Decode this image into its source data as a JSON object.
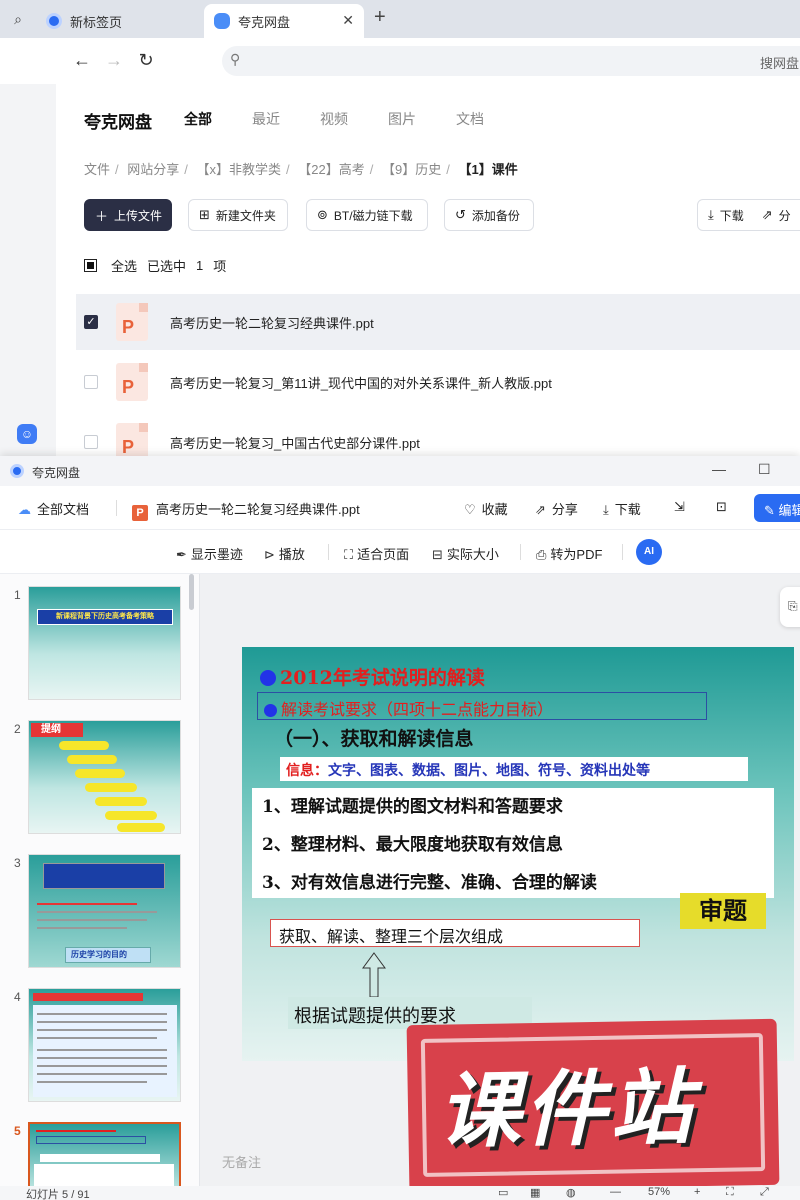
{
  "browser": {
    "tabs": [
      {
        "label": "新标签页"
      },
      {
        "label": "夸克网盘"
      }
    ],
    "address_hint": "搜网盘"
  },
  "drive": {
    "brand": "夸克网盘",
    "nav": [
      "全部",
      "最近",
      "视频",
      "图片",
      "文档"
    ],
    "breadcrumb": [
      "文件",
      "网站分享",
      "【x】非教学类",
      "【22】高考",
      "【9】历史",
      "【1】课件"
    ],
    "toolbar": {
      "upload": "上传文件",
      "new_folder": "新建文件夹",
      "bt": "BT/磁力链下载",
      "backup": "添加备份",
      "download": "下载",
      "share": "分"
    },
    "selection": {
      "all": "全选",
      "selected": "已选中",
      "count": "1",
      "unit": "项"
    },
    "files": [
      {
        "name": "高考历史一轮二轮复习经典课件.ppt"
      },
      {
        "name": "高考历史一轮复习_第11讲_现代中国的对外关系课件_新人教版.ppt"
      },
      {
        "name": "高考历史一轮复习_中国古代史部分课件.ppt"
      }
    ]
  },
  "viewer": {
    "window_title": "夸克网盘",
    "all_docs": "全部文档",
    "file_name": "高考历史一轮二轮复习经典课件.ppt",
    "actions": {
      "favorite": "收藏",
      "share": "分享",
      "download": "下载",
      "edit": "编辑"
    },
    "tools": {
      "ink": "显示墨迹",
      "play": "播放",
      "fit": "适合页面",
      "actual": "实际大小",
      "to_pdf": "转为PDF",
      "ai": "AI"
    },
    "thumbs": [
      {
        "num": "1",
        "text": "新课程背景下历史高考备考策略"
      },
      {
        "num": "2",
        "text": "提纲"
      },
      {
        "num": "3",
        "text": "历史学习的目的"
      },
      {
        "num": "4",
        "text": ""
      },
      {
        "num": "5",
        "text": ""
      }
    ],
    "slide": {
      "title": "2012年考试说明的解读",
      "subtitle": "解读考试要求（四项十二点能力目标）",
      "heading": "（一）、获取和解读信息",
      "info_label": "信息：",
      "info_text": "文字、图表、数据、图片、地图、符号、资料出处等",
      "items": [
        "1、理解试题提供的图文材料和答题要求",
        "2、整理材料、最大限度地获取有效信息",
        "3、对有效信息进行完整、准确、合理的解读"
      ],
      "review": "审题",
      "levels": "获取、解读、整理三个层次组成",
      "basis": "根据试题提供的要求"
    },
    "notes": "无备注",
    "status": "幻灯片 5 / 91",
    "zoom": "57%"
  },
  "watermark": "课件站"
}
